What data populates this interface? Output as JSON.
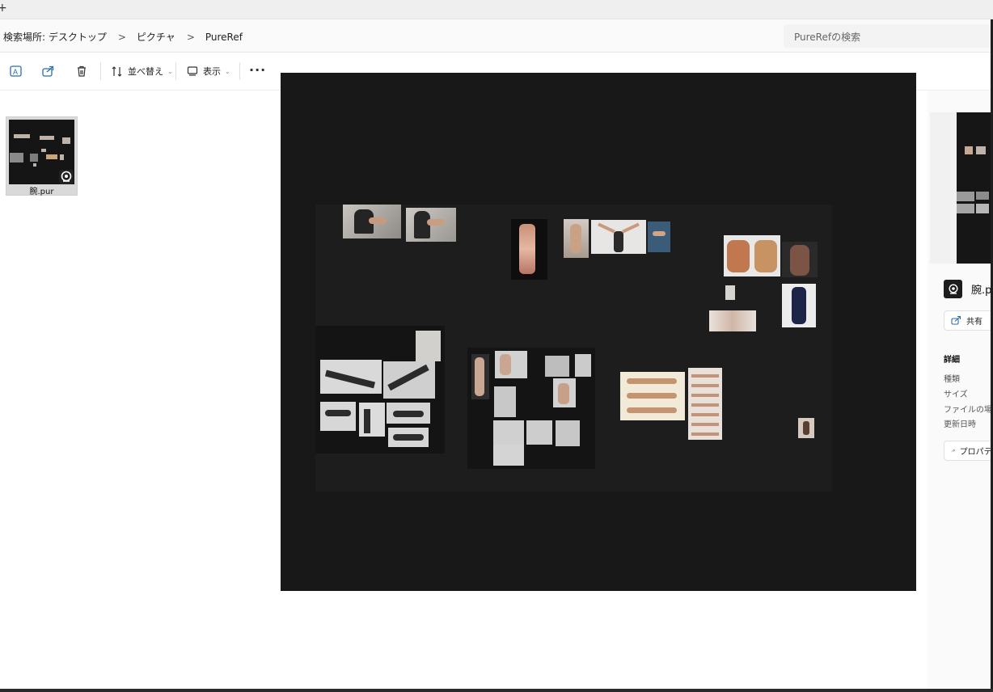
{
  "titlebar": {
    "new_tab_glyph": "+"
  },
  "breadcrumb": {
    "items": [
      "検索場所: デスクトップ",
      "ピクチャ",
      "PureRef"
    ],
    "separator": ">"
  },
  "search": {
    "placeholder": "PureRefの検索"
  },
  "toolbar": {
    "sort_label": "並べ替え",
    "view_label": "表示",
    "more_label": "···"
  },
  "files": [
    {
      "name": "腕.pur",
      "icon": "pureref-icon",
      "selected": true
    }
  ],
  "details": {
    "file_name": "腕.pur",
    "share_label": "共有",
    "section_title": "詳細",
    "properties": [
      "種類",
      "サイズ",
      "ファイルの場所",
      "更新日時"
    ],
    "properties_button": "プロパティ"
  },
  "colors": {
    "preview_bg": "#181818",
    "canvas_bg": "#1d1d1d",
    "group_bg": "#141414",
    "selection": "#d9d9d9"
  }
}
